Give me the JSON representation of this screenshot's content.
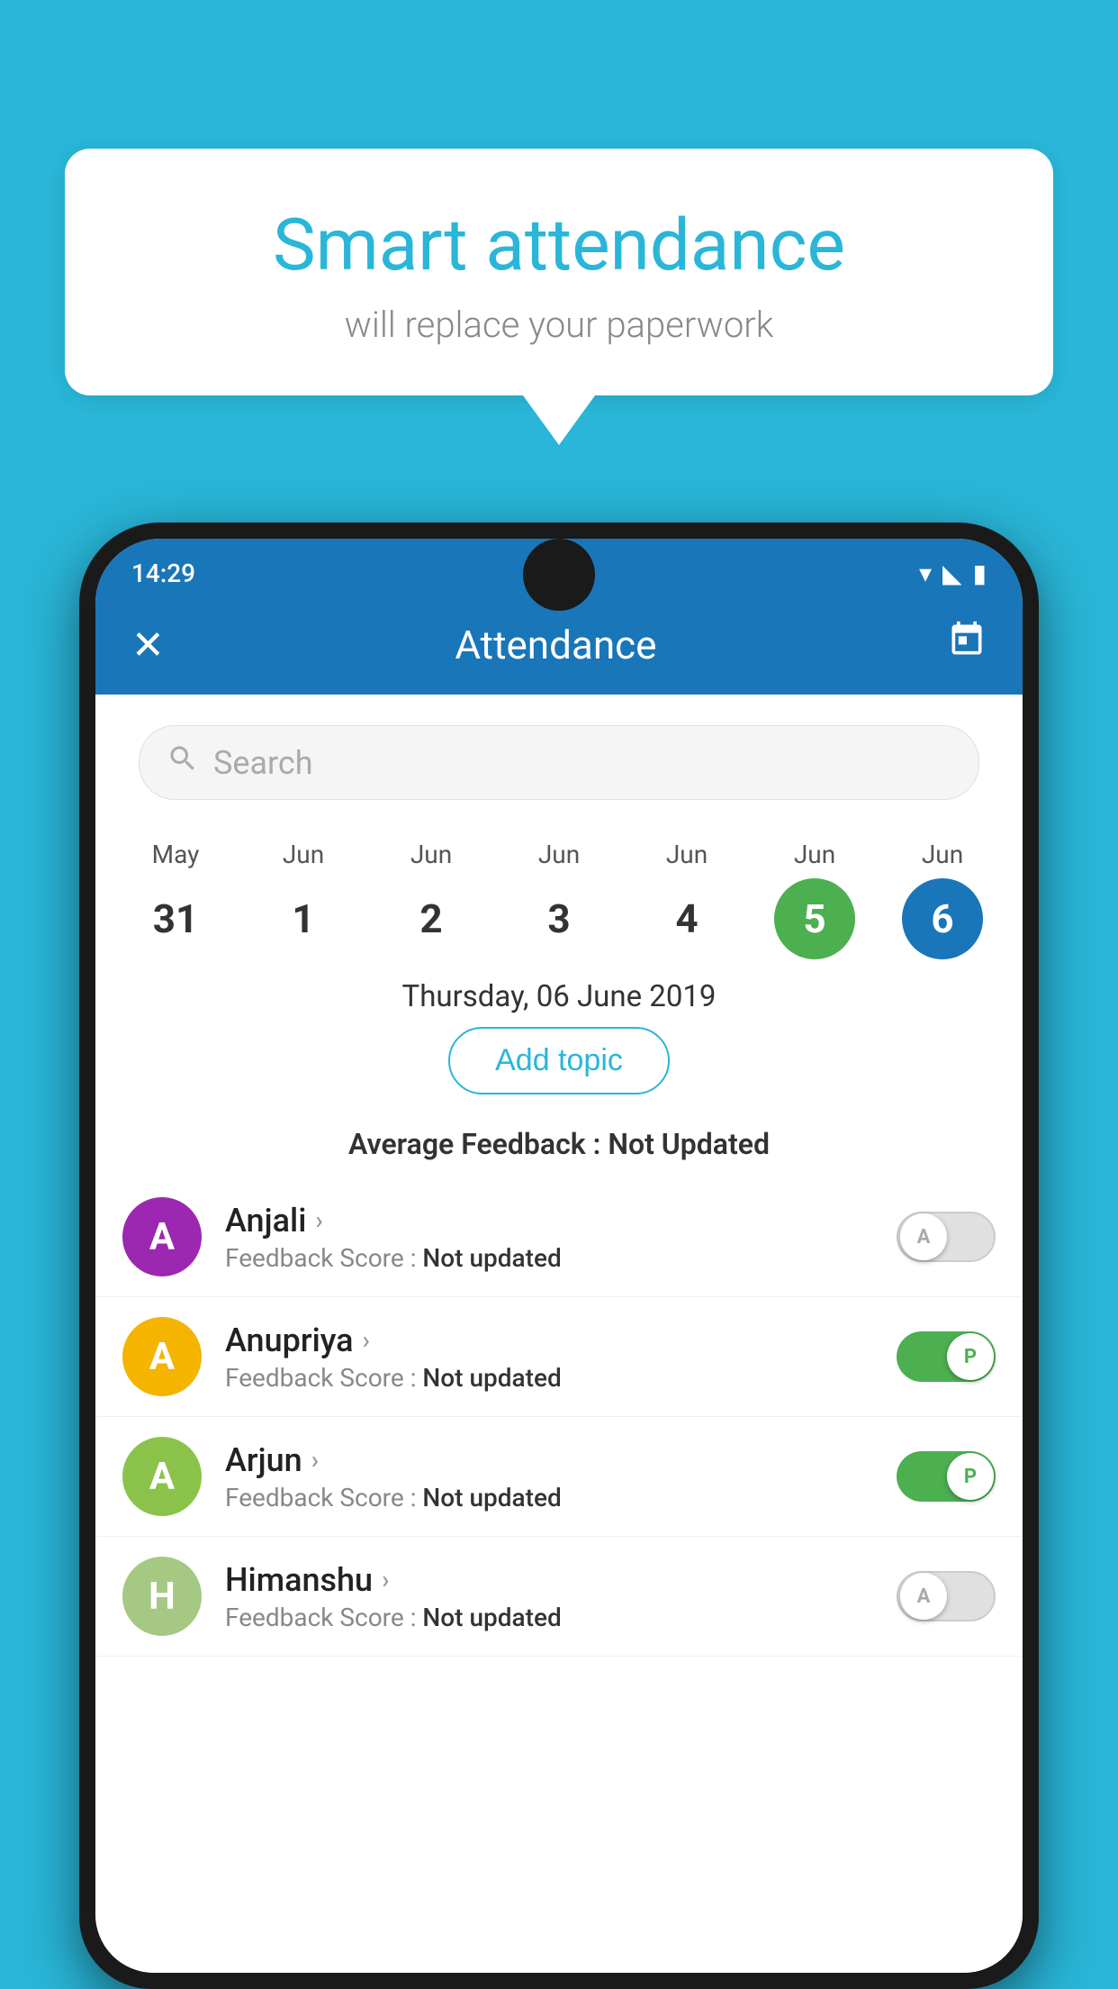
{
  "background_color": "#29b6d8",
  "bubble": {
    "title": "Smart attendance",
    "subtitle": "will replace your paperwork"
  },
  "status_bar": {
    "time": "14:29",
    "icons": [
      "wifi",
      "signal",
      "battery"
    ]
  },
  "header": {
    "title": "Attendance",
    "close_label": "✕",
    "calendar_label": "📅"
  },
  "search": {
    "placeholder": "Search"
  },
  "calendar": {
    "days": [
      {
        "month": "May",
        "date": "31",
        "state": "normal"
      },
      {
        "month": "Jun",
        "date": "1",
        "state": "normal"
      },
      {
        "month": "Jun",
        "date": "2",
        "state": "normal"
      },
      {
        "month": "Jun",
        "date": "3",
        "state": "normal"
      },
      {
        "month": "Jun",
        "date": "4",
        "state": "normal"
      },
      {
        "month": "Jun",
        "date": "5",
        "state": "today"
      },
      {
        "month": "Jun",
        "date": "6",
        "state": "selected"
      }
    ]
  },
  "selected_date": "Thursday, 06 June 2019",
  "add_topic_label": "Add topic",
  "avg_feedback": {
    "label": "Average Feedback : ",
    "value": "Not Updated"
  },
  "students": [
    {
      "name": "Anjali",
      "avatar_letter": "A",
      "avatar_color": "#9c27b0",
      "feedback_label": "Feedback Score : ",
      "feedback_value": "Not updated",
      "toggle_state": "off",
      "toggle_letter": "A"
    },
    {
      "name": "Anupriya",
      "avatar_letter": "A",
      "avatar_color": "#f4b400",
      "feedback_label": "Feedback Score : ",
      "feedback_value": "Not updated",
      "toggle_state": "on",
      "toggle_letter": "P"
    },
    {
      "name": "Arjun",
      "avatar_letter": "A",
      "avatar_color": "#8bc34a",
      "feedback_label": "Feedback Score : ",
      "feedback_value": "Not updated",
      "toggle_state": "on",
      "toggle_letter": "P"
    },
    {
      "name": "Himanshu",
      "avatar_letter": "H",
      "avatar_color": "#a5c882",
      "feedback_label": "Feedback Score : ",
      "feedback_value": "Not updated",
      "toggle_state": "off",
      "toggle_letter": "A"
    }
  ]
}
